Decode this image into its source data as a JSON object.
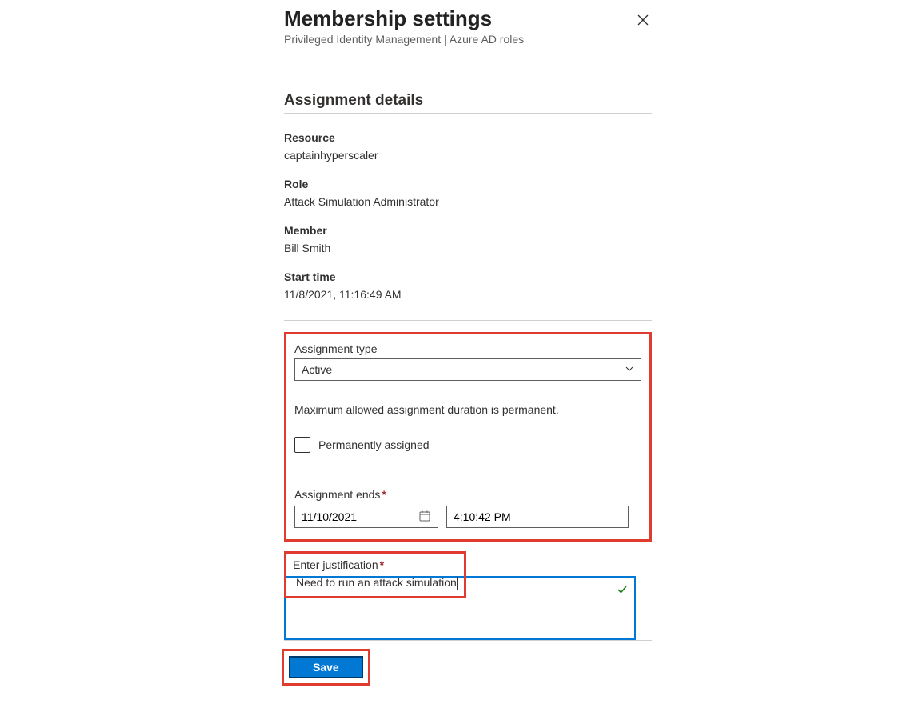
{
  "header": {
    "title": "Membership settings",
    "subtitle": "Privileged Identity Management | Azure AD roles"
  },
  "section": {
    "heading": "Assignment details"
  },
  "details": {
    "resource_label": "Resource",
    "resource_value": "captainhyperscaler",
    "role_label": "Role",
    "role_value": "Attack Simulation Administrator",
    "member_label": "Member",
    "member_value": "Bill Smith",
    "start_label": "Start time",
    "start_value": "11/8/2021, 11:16:49 AM"
  },
  "assignment": {
    "type_label": "Assignment type",
    "type_value": "Active",
    "duration_note": "Maximum allowed assignment duration is permanent.",
    "perm_label": "Permanently assigned",
    "ends_label": "Assignment ends",
    "ends_date": "11/10/2021",
    "ends_time": "4:10:42 PM"
  },
  "justification": {
    "label": "Enter justification",
    "value": "Need to run an attack simulation"
  },
  "footer": {
    "save_label": "Save"
  }
}
